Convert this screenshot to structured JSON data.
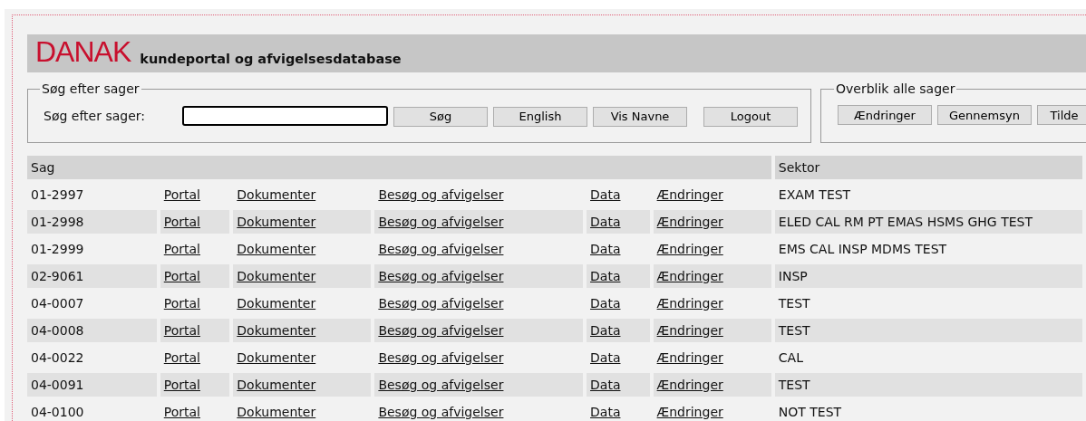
{
  "header": {
    "logo": "DANAK",
    "title": "kundeportal og afvigelsesdatabase"
  },
  "search_panel": {
    "legend": "Søg efter sager",
    "label": "Søg efter sager:",
    "buttons": [
      "Søg",
      "English",
      "Vis Navne",
      "Logout"
    ]
  },
  "overview_panel": {
    "legend": "Overblik alle sager",
    "buttons": [
      "Ændringer",
      "Gennemsyn",
      "Tilde"
    ]
  },
  "table": {
    "columns": [
      "Sag",
      "Sektor"
    ],
    "rows": [
      {
        "sag": "01-2997",
        "links": [
          "Portal",
          "Dokumenter",
          "Besøg og afvigelser",
          "Data",
          "Ændringer"
        ],
        "sektor": "EXAM TEST"
      },
      {
        "sag": "01-2998",
        "links": [
          "Portal",
          "Dokumenter",
          "Besøg og afvigelser",
          "Data",
          "Ændringer"
        ],
        "sektor": "ELED CAL RM PT EMAS HSMS GHG TEST"
      },
      {
        "sag": "01-2999",
        "links": [
          "Portal",
          "Dokumenter",
          "Besøg og afvigelser",
          "Data",
          "Ændringer"
        ],
        "sektor": "EMS CAL INSP MDMS TEST"
      },
      {
        "sag": "02-9061",
        "links": [
          "Portal",
          "Dokumenter",
          "Besøg og afvigelser",
          "Data",
          "Ændringer"
        ],
        "sektor": "INSP"
      },
      {
        "sag": "04-0007",
        "links": [
          "Portal",
          "Dokumenter",
          "Besøg og afvigelser",
          "Data",
          "Ændringer"
        ],
        "sektor": "TEST"
      },
      {
        "sag": "04-0008",
        "links": [
          "Portal",
          "Dokumenter",
          "Besøg og afvigelser",
          "Data",
          "Ændringer"
        ],
        "sektor": "TEST"
      },
      {
        "sag": "04-0022",
        "links": [
          "Portal",
          "Dokumenter",
          "Besøg og afvigelser",
          "Data",
          "Ændringer"
        ],
        "sektor": "CAL"
      },
      {
        "sag": "04-0091",
        "links": [
          "Portal",
          "Dokumenter",
          "Besøg og afvigelser",
          "Data",
          "Ændringer"
        ],
        "sektor": "TEST"
      },
      {
        "sag": "04-0100",
        "links": [
          "Portal",
          "Dokumenter",
          "Besøg og afvigelser",
          "Data",
          "Ændringer"
        ],
        "sektor": "NOT TEST"
      }
    ]
  }
}
